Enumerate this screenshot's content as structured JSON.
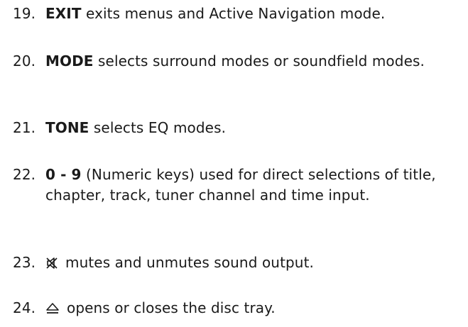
{
  "items": [
    {
      "number": "19.",
      "keyword": "EXIT",
      "text": " exits menus and Active Navigation mode."
    },
    {
      "number": "20.",
      "keyword": "MODE",
      "text": " selects surround modes or soundfield modes."
    },
    {
      "number": "21.",
      "keyword": "TONE",
      "text": " selects EQ modes."
    },
    {
      "number": "22.",
      "keyword": "0 - 9",
      "text": " (Numeric keys) used for direct selections of title, chapter, track, tuner channel and time input."
    },
    {
      "number": "23.",
      "icon": "mute-icon",
      "text": "mutes and unmutes sound output."
    },
    {
      "number": "24.",
      "icon": "eject-icon",
      "text": "opens or closes the disc tray."
    }
  ]
}
